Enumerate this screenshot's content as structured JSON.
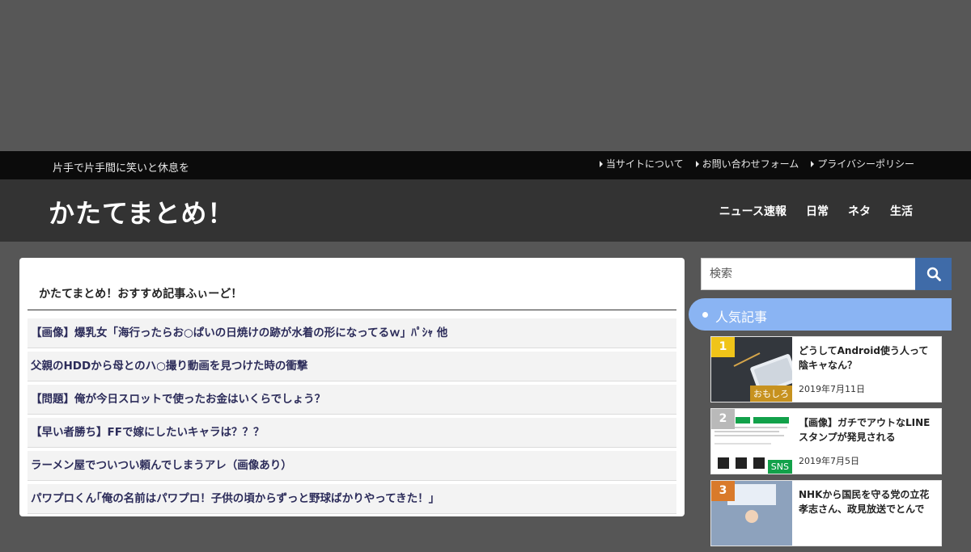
{
  "topbar": {
    "tagline": "片手で片手間に笑いと休息を",
    "links": [
      "当サイトについて",
      "お問い合わせフォーム",
      "プライバシーポリシー"
    ]
  },
  "header": {
    "site_title": "かたてまとめ！",
    "nav": [
      "ニュース速報",
      "日常",
      "ネタ",
      "生活"
    ]
  },
  "main": {
    "section_title": "かたてまとめ！おすすめ記事ふぃーど！",
    "posts": [
      "【画像】爆乳女「海行ったらお○ぱいの日焼けの跡が水着の形になってるｗ」ﾊﾟｼｬ 他",
      "父親のHDDから母とのハ○撮り動画を見つけた時の衝撃",
      "【問題】俺が今日スロットで使ったお金はいくらでしょう？",
      "【早い者勝ち】FFで嫁にしたいキャラは？？？",
      "ラーメン屋でついつい頼んでしまうアレ（画像あり）",
      "パワプロくん｢俺の名前はパワプロ！子供の頃からずっと野球ばかりやってきた！」"
    ]
  },
  "sidebar": {
    "search_placeholder": "検索",
    "widget_title": "人気記事",
    "ranking": [
      {
        "rank": "1",
        "title": "どうしてAndroid使う人って陰キャなん？",
        "date": "2019年7月11日",
        "category": "おもしろ",
        "rank_color": "#f0c419",
        "category_color": "#c7921f"
      },
      {
        "rank": "2",
        "title": "【画像】ガチでアウトなLINEスタンプが発見される",
        "date": "2019年7月5日",
        "category": "SNS",
        "rank_color": "#b9b9b9",
        "category_color": "#12a14a"
      },
      {
        "rank": "3",
        "title": "NHKから国民を守る党の立花孝志さん、政見放送でとんで",
        "date": "",
        "category": "",
        "rank_color": "#d97a2b",
        "category_color": "#000000"
      }
    ]
  },
  "colors": {
    "accent_blue": "#3f6ba8",
    "widget_blue": "#8ab4f3",
    "header_bg": "#333333",
    "topbar_bg": "#0b0b0b"
  }
}
